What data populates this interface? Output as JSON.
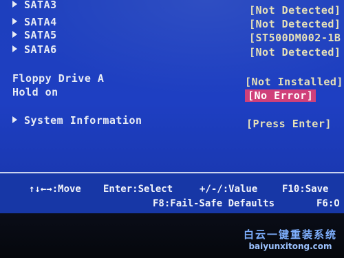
{
  "sata_items": [
    {
      "label": "SATA3",
      "value": "[Not Detected]"
    },
    {
      "label": "SATA4",
      "value": "[Not Detected]"
    },
    {
      "label": "SATA5",
      "value": "[ST500DM002-1B"
    },
    {
      "label": "SATA6",
      "value": "[Not Detected]"
    }
  ],
  "floppy": {
    "label": "Floppy Drive A",
    "value": "[Not Installed]"
  },
  "hold_on": {
    "label": "Hold on",
    "value": "[No Error]"
  },
  "system_info": {
    "label": "System Information",
    "value": "[Press Enter]"
  },
  "footer": {
    "move": "↑↓←→:Move",
    "select": "Enter:Select",
    "value": "+/-/:Value",
    "save": "F10:Save",
    "failsafe": "F8:Fail-Safe Defaults",
    "f6": "F6:O"
  },
  "watermark": {
    "cn": "白云一键重装系统",
    "url": "baiyunxitong.com"
  },
  "colors": {
    "background": "#1e3fc2",
    "value_text": "#e6e1b8",
    "highlight": "#d0407a"
  }
}
